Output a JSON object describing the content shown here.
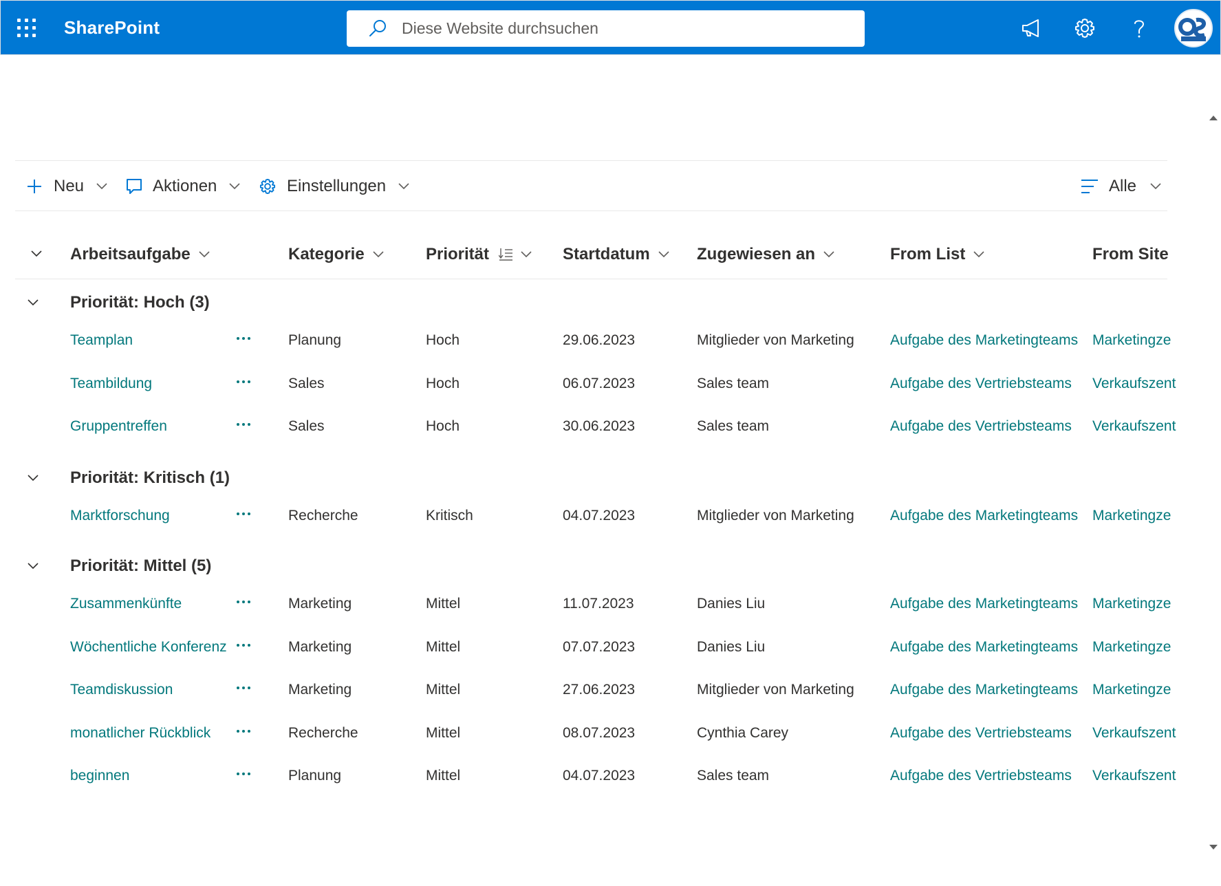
{
  "suite_bar": {
    "app_name": "SharePoint",
    "search_placeholder": "Diese Website durchsuchen",
    "icons": [
      "waffle-icon",
      "megaphone-icon",
      "gear-icon",
      "help-icon",
      "avatar"
    ],
    "bar_color": "#0078d4"
  },
  "command_bar": {
    "new_label": "Neu",
    "actions_label": "Aktionen",
    "settings_label": "Einstellungen",
    "view_label": "Alle"
  },
  "columns": [
    "Arbeitsaufgabe",
    "Kategorie",
    "Priorität",
    "Startdatum",
    "Zugewiesen an",
    "From List",
    "From Site"
  ],
  "groups": [
    {
      "title": "Priorität: Hoch (3)",
      "rows": [
        {
          "task": "Teamplan",
          "category": "Planung",
          "priority": "Hoch",
          "start": "29.06.2023",
          "assigned": "Mitglieder von Marketing",
          "from_list": "Aufgabe des Marketingteams",
          "from_site": "Marketingze"
        },
        {
          "task": "Teambildung",
          "category": "Sales",
          "priority": "Hoch",
          "start": "06.07.2023",
          "assigned": "Sales team",
          "from_list": "Aufgabe des Vertriebsteams",
          "from_site": "Verkaufszent"
        },
        {
          "task": "Gruppentreffen",
          "category": "Sales",
          "priority": "Hoch",
          "start": "30.06.2023",
          "assigned": "Sales team",
          "from_list": "Aufgabe des Vertriebsteams",
          "from_site": "Verkaufszent"
        }
      ]
    },
    {
      "title": "Priorität: Kritisch (1)",
      "rows": [
        {
          "task": "Marktforschung",
          "category": "Recherche",
          "priority": "Kritisch",
          "start": "04.07.2023",
          "assigned": "Mitglieder von Marketing",
          "from_list": "Aufgabe des Marketingteams",
          "from_site": "Marketingze"
        }
      ]
    },
    {
      "title": "Priorität: Mittel (5)",
      "rows": [
        {
          "task": "Zusammenkünfte",
          "category": "Marketing",
          "priority": "Mittel",
          "start": "11.07.2023",
          "assigned": "Danies Liu",
          "from_list": "Aufgabe des Marketingteams",
          "from_site": "Marketingze"
        },
        {
          "task": "Wöchentliche Konferenz",
          "category": "Marketing",
          "priority": "Mittel",
          "start": "07.07.2023",
          "assigned": "Danies Liu",
          "from_list": "Aufgabe des Marketingteams",
          "from_site": "Marketingze"
        },
        {
          "task": "Teamdiskussion",
          "category": "Marketing",
          "priority": "Mittel",
          "start": "27.06.2023",
          "assigned": "Mitglieder von Marketing",
          "from_list": "Aufgabe des Marketingteams",
          "from_site": "Marketingze"
        },
        {
          "task": "monatlicher Rückblick",
          "category": "Recherche",
          "priority": "Mittel",
          "start": "08.07.2023",
          "assigned": "Cynthia Carey",
          "from_list": "Aufgabe des Vertriebsteams",
          "from_site": "Verkaufszent"
        },
        {
          "task": "beginnen",
          "category": "Planung",
          "priority": "Mittel",
          "start": "04.07.2023",
          "assigned": "Sales team",
          "from_list": "Aufgabe des Vertriebsteams",
          "from_site": "Verkaufszent"
        }
      ]
    }
  ],
  "colors": {
    "link": "#03787c",
    "text": "#323130",
    "brand": "#0078d4"
  }
}
